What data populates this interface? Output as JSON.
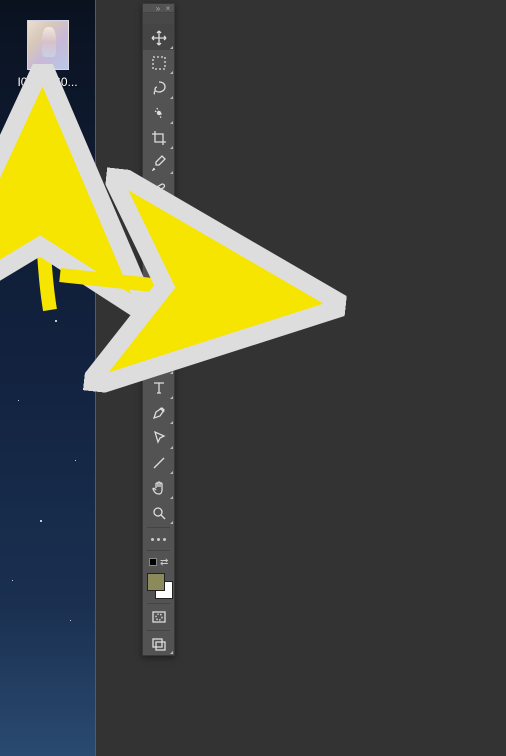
{
  "desktop": {
    "icon": {
      "label": "I0001360...",
      "thumb_alt": "photo-thumbnail"
    }
  },
  "toolbox": {
    "header": {
      "collapse": "»",
      "close": "×"
    },
    "tools": [
      {
        "name": "move-tool",
        "icon": "move"
      },
      {
        "name": "marquee-tool",
        "icon": "marquee"
      },
      {
        "name": "lasso-tool",
        "icon": "lasso"
      },
      {
        "name": "quick-select-tool",
        "icon": "quickselect"
      },
      {
        "name": "crop-tool",
        "icon": "crop"
      },
      {
        "name": "eyedropper-tool",
        "icon": "eyedropper"
      },
      {
        "name": "healing-brush-tool",
        "icon": "bandage"
      },
      {
        "name": "brush-tool",
        "icon": "brush"
      },
      {
        "name": "clone-stamp-tool",
        "icon": "stamp"
      },
      {
        "name": "history-brush-tool",
        "icon": "historybrush"
      },
      {
        "name": "eraser-tool",
        "icon": "eraser"
      },
      {
        "name": "gradient-tool",
        "icon": "gradient"
      },
      {
        "name": "blur-tool",
        "icon": "blur"
      },
      {
        "name": "dodge-tool",
        "icon": "dodge"
      },
      {
        "name": "type-tool",
        "icon": "type"
      },
      {
        "name": "pen-tool",
        "icon": "pen"
      },
      {
        "name": "path-select-tool",
        "icon": "pathselect"
      },
      {
        "name": "line-tool",
        "icon": "line"
      },
      {
        "name": "hand-tool",
        "icon": "hand"
      },
      {
        "name": "zoom-tool",
        "icon": "zoom"
      }
    ],
    "colors": {
      "foreground": "#8a8a5a",
      "background": "#ffffff"
    },
    "bottom": {
      "quickmask": "quickmask",
      "screenmode": "screenmode"
    }
  },
  "annotations": {
    "arrow1": "points from workspace toward desktop icon (up)",
    "arrow2": "points from workspace toward canvas (right)"
  }
}
